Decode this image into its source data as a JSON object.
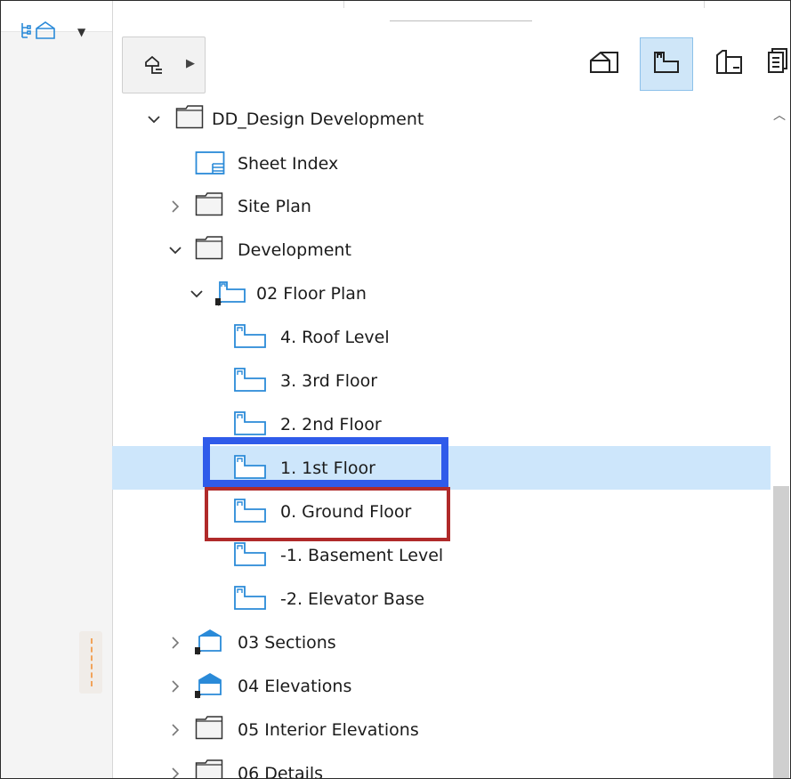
{
  "toolbar": {
    "navigator_mode_icon": "project-map-icon",
    "tree_options_icon": "tree-options-icon",
    "views": [
      {
        "icon": "project-map-icon",
        "active": false
      },
      {
        "icon": "view-map-icon",
        "active": true
      },
      {
        "icon": "layout-book-icon",
        "active": false
      },
      {
        "icon": "publisher-sets-icon",
        "active": false
      }
    ]
  },
  "tree": {
    "items": [
      {
        "label": "DD_Design Development",
        "icon": "folder-icon",
        "expanded": true
      },
      {
        "label": "Sheet Index",
        "icon": "sheet-index-icon"
      },
      {
        "label": "Site Plan",
        "icon": "folder-icon",
        "expanded": false
      },
      {
        "label": "Development",
        "icon": "folder-icon",
        "expanded": true
      },
      {
        "label": "02 Floor Plan",
        "icon": "floor-plan-folder-icon",
        "expanded": true
      },
      {
        "label": "4. Roof Level",
        "icon": "floor-plan-icon"
      },
      {
        "label": "3. 3rd Floor",
        "icon": "floor-plan-icon"
      },
      {
        "label": "2. 2nd Floor",
        "icon": "floor-plan-icon"
      },
      {
        "label": "1. 1st Floor",
        "icon": "floor-plan-icon",
        "selected": true
      },
      {
        "label": "0. Ground Floor",
        "icon": "floor-plan-icon"
      },
      {
        "label": "-1. Basement Level",
        "icon": "floor-plan-icon"
      },
      {
        "label": "-2. Elevator Base",
        "icon": "floor-plan-icon"
      },
      {
        "label": "03 Sections",
        "icon": "section-folder-icon",
        "expanded": false
      },
      {
        "label": "04 Elevations",
        "icon": "elevation-folder-icon",
        "expanded": false
      },
      {
        "label": "05 Interior Elevations",
        "icon": "folder-icon",
        "expanded": false
      },
      {
        "label": "06 Details",
        "icon": "folder-icon",
        "expanded": false
      }
    ]
  },
  "colors": {
    "selection": "#cde6fb",
    "active_view_button": "#cfe6f8",
    "icon_blue": "#2a8ad8",
    "highlight_blue": "#2f5bea",
    "highlight_red": "#b02a2a"
  }
}
